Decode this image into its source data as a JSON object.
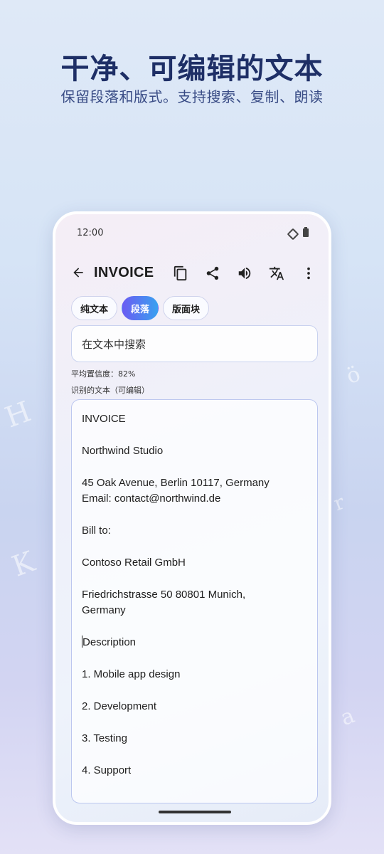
{
  "promo": {
    "headline": "干净、可编辑的文本",
    "subline": "保留段落和版式。支持搜索、复制、朗读"
  },
  "status_bar": {
    "time": "12:00",
    "icons": [
      "satellite-icon",
      "battery-icon"
    ]
  },
  "toolbar": {
    "title": "INVOICE",
    "icons": [
      "back-arrow-icon",
      "copy-icon",
      "share-icon",
      "speaker-icon",
      "translate-icon",
      "more-vert-icon"
    ]
  },
  "modes": {
    "items": [
      {
        "label": "纯文本",
        "active": false
      },
      {
        "label": "段落",
        "active": true
      },
      {
        "label": "版面块",
        "active": false
      }
    ]
  },
  "search": {
    "placeholder": "在文本中搜索"
  },
  "confidence": {
    "text": "平均置信度：82%"
  },
  "recognized": {
    "label": "识别的文本（可编辑）",
    "paragraphs": [
      "INVOICE",
      "Northwind Studio",
      "45 Oak Avenue, Berlin 10117, Germany\nEmail: contact@northwind.de",
      "Bill to:",
      "Contoso Retail GmbH",
      "Friedrichstrasse 50 80801 Munich,\nGermany",
      "Description",
      "1. Mobile app design",
      "2. Development",
      "3. Testing",
      "4. Support"
    ]
  },
  "colors": {
    "accent_start": "#6a5cf2",
    "accent_end": "#3aa0f0",
    "headline": "#1e2f66"
  }
}
